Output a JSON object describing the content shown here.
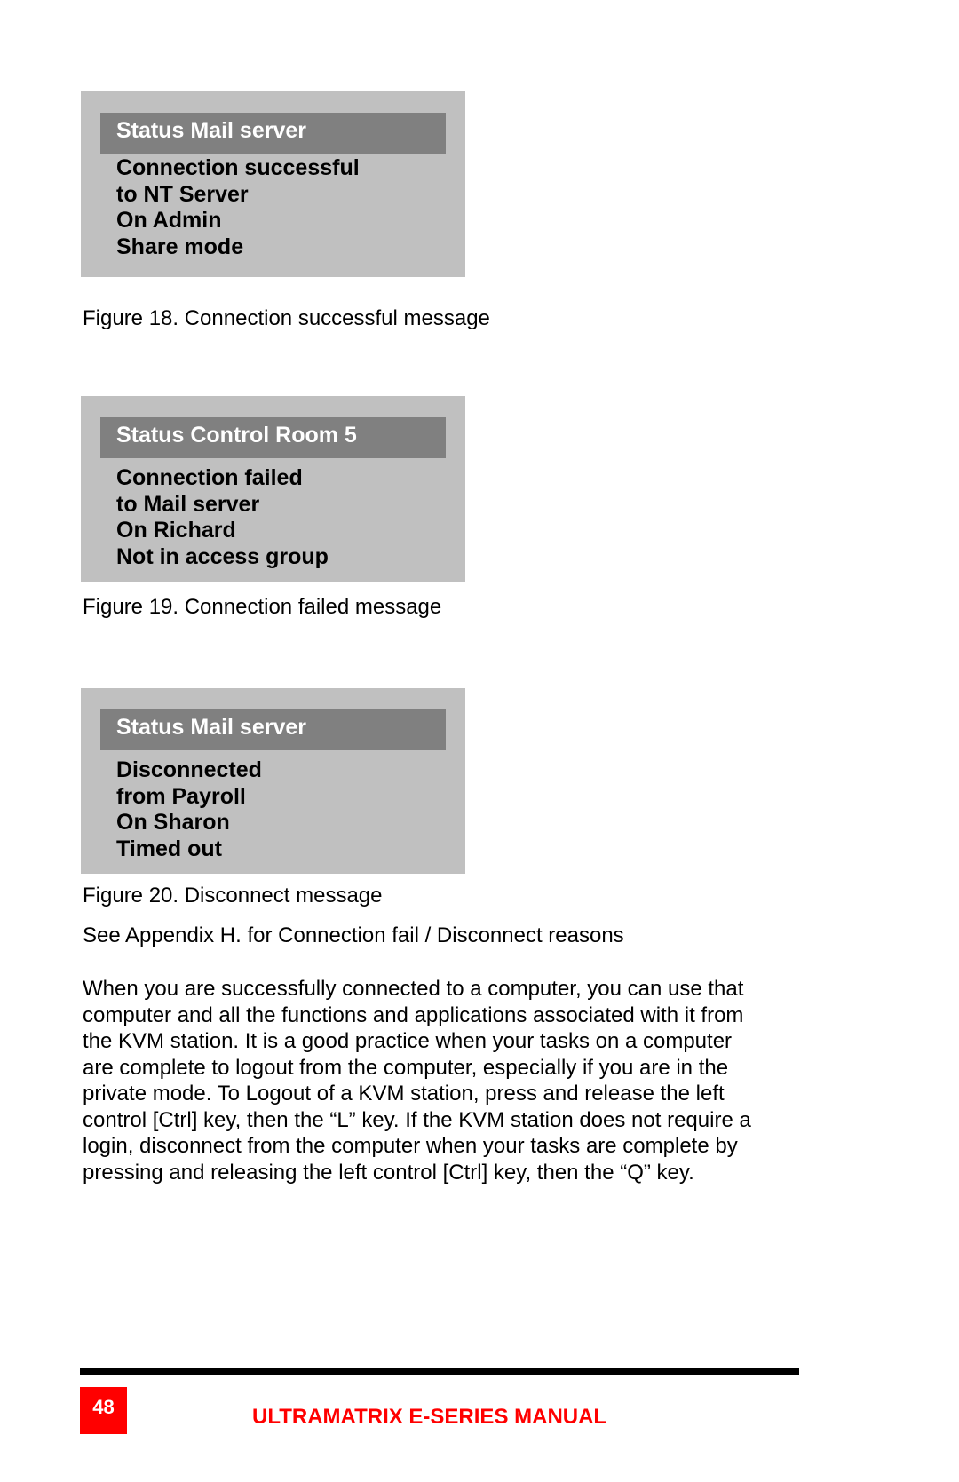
{
  "figures": [
    {
      "header": "Status Mail server",
      "lines": [
        "Connection successful",
        "to NT Server",
        "On Admin",
        "Share mode"
      ],
      "caption": "Figure 18. Connection successful message"
    },
    {
      "header": "Status Control Room 5",
      "lines": [
        "Connection failed",
        "to Mail server",
        "On Richard",
        "Not in access group"
      ],
      "caption": "Figure 19. Connection failed message"
    },
    {
      "header": "Status Mail server",
      "lines": [
        "Disconnected",
        "from Payroll",
        "On Sharon",
        "Timed out"
      ],
      "caption": "Figure 20. Disconnect message"
    }
  ],
  "appendix_note": "See Appendix H. for Connection fail / Disconnect reasons",
  "body_paragraph": {
    "lines": [
      "When you are successfully connected to a computer, you can use that",
      "computer and all the functions and applications associated with it from",
      "the KVM station.  It is a good practice when your tasks on a computer",
      "are complete to logout from the computer, especially if you are in the",
      "private mode.  To Logout of a KVM station, press and release the left",
      "control [Ctrl] key, then the “L” key. If the KVM station does not require a",
      "login, disconnect from the computer when your tasks are complete by",
      "pressing and releasing the left control [Ctrl] key, then the “Q” key."
    ]
  },
  "footer": {
    "page_number": "48",
    "manual_title": "ULTRAMATRIX E-SERIES MANUAL",
    "accent_color": "#ff0000"
  }
}
